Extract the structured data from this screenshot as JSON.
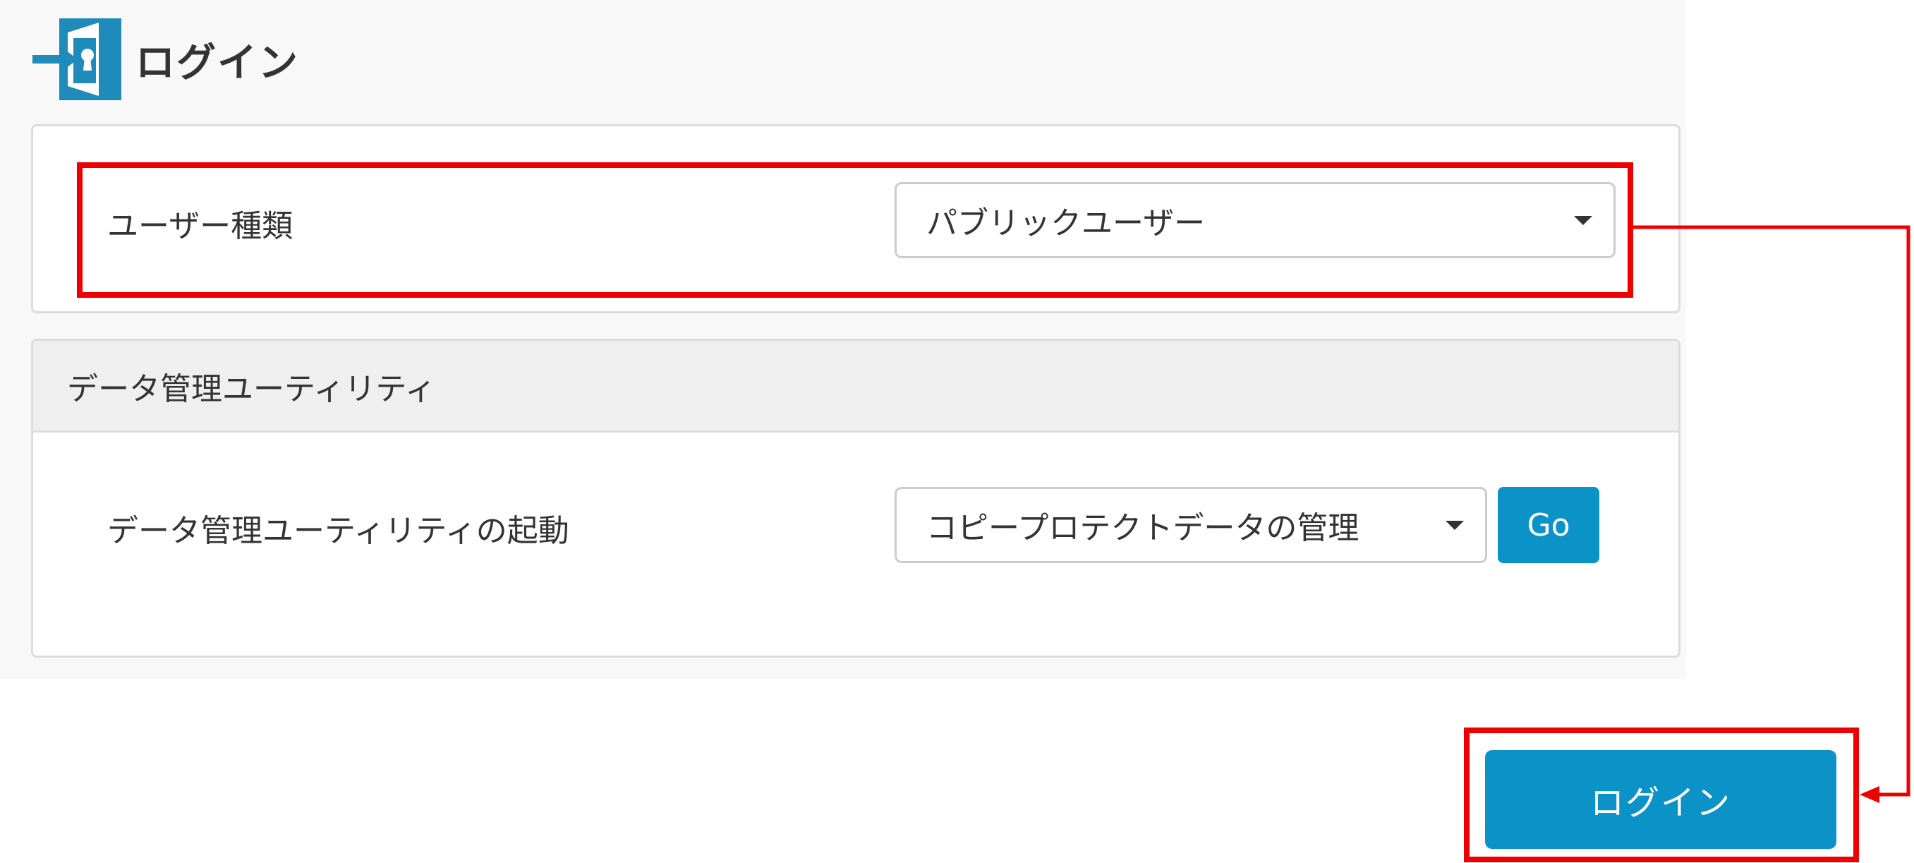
{
  "header": {
    "title": "ログイン",
    "icon": "login-door-icon"
  },
  "user_type": {
    "label": "ユーザー種類",
    "selected": "パブリックユーザー"
  },
  "utility": {
    "section_title": "データ管理ユーティリティ",
    "launch_label": "データ管理ユーティリティの起動",
    "selected": "コピープロテクトデータの管理",
    "go_label": "Go"
  },
  "login_button": {
    "label": "ログイン"
  },
  "colors": {
    "accent": "#0b93c8",
    "icon_blue": "#1f8bbb",
    "highlight": "#ee0000",
    "panel_bg": "#f8f8f8",
    "card_header_bg": "#efefef"
  }
}
